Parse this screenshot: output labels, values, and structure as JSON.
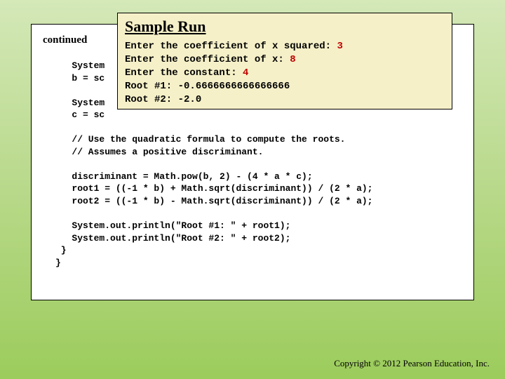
{
  "slide": {
    "continued_label": "continued",
    "code_lines": [
      "   System",
      "   b = sc",
      "",
      "   System",
      "   c = sc",
      "",
      "   // Use the quadratic formula to compute the roots.",
      "   // Assumes a positive discriminant.",
      "",
      "   discriminant = Math.pow(b, 2) - (4 * a * c);",
      "   root1 = ((-1 * b) + Math.sqrt(discriminant)) / (2 * a);",
      "   root2 = ((-1 * b) - Math.sqrt(discriminant)) / (2 * a);",
      "",
      "   System.out.println(\"Root #1: \" + root1);",
      "   System.out.println(\"Root #2: \" + root2);",
      " }",
      "}"
    ],
    "sample_title": "Sample Run",
    "sample_lines": [
      {
        "prompt": "Enter the coefficient of x squared: ",
        "input": "3"
      },
      {
        "prompt": "Enter the coefficient of x: ",
        "input": "8"
      },
      {
        "prompt": "Enter the constant: ",
        "input": "4"
      },
      {
        "prompt": "Root #1: -0.6666666666666666",
        "input": ""
      },
      {
        "prompt": "Root #2: -2.0",
        "input": ""
      }
    ],
    "copyright": "Copyright © 2012 Pearson Education, Inc."
  }
}
